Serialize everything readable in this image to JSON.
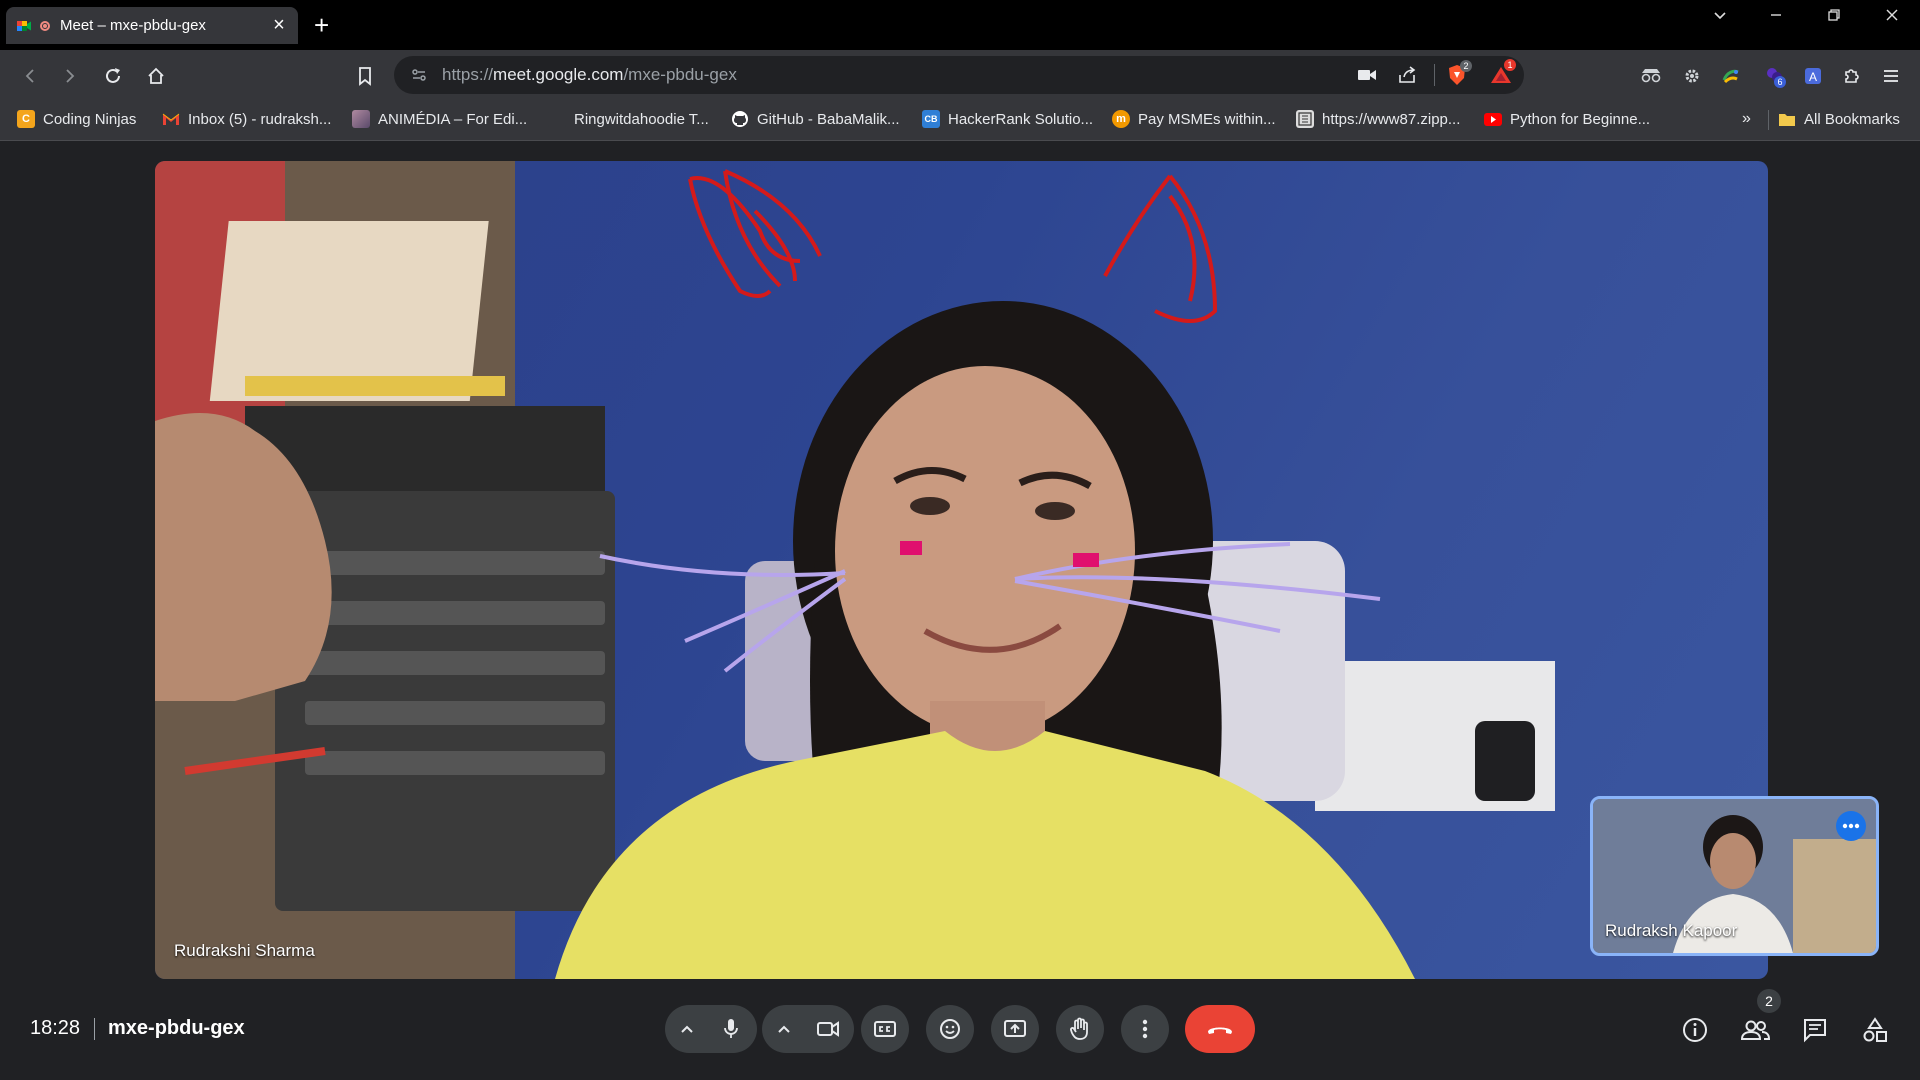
{
  "browser": {
    "tab_title": "Meet – mxe-pbdu-gex",
    "url_prefix": "https://",
    "url_host": "meet.google.com",
    "url_path": "/mxe-pbdu-gex",
    "brave_badge": "2",
    "alert_badge": "1",
    "extension_badge": "6"
  },
  "bookmarks": [
    {
      "label": "Coding Ninjas",
      "icon": "coding-ninjas-icon",
      "color": "#f4a51c"
    },
    {
      "label": "Inbox (5) - rudraksh...",
      "icon": "gmail-icon",
      "color": "#ea4335"
    },
    {
      "label": "ANIMÉDIA – For Edi...",
      "icon": "animedia-icon",
      "color": "#8a6d8f"
    },
    {
      "label": "Ringwitdahoodie T...",
      "icon": "ringwitdahoodie-icon",
      "color": "#444"
    },
    {
      "label": "GitHub - BabaMalik...",
      "icon": "github-icon",
      "color": "#ffffff"
    },
    {
      "label": "HackerRank Solutio...",
      "icon": "hackerrank-icon",
      "color": "#2f7fd6"
    },
    {
      "label": "Pay MSMEs within...",
      "icon": "msme-icon",
      "color": "#f29900"
    },
    {
      "label": "https://www87.zipp...",
      "icon": "zipp-icon",
      "color": "#dddddd"
    },
    {
      "label": "Python for Beginne...",
      "icon": "youtube-icon",
      "color": "#ff0000"
    }
  ],
  "bookmarks_overflow": "»",
  "all_bookmarks": "All Bookmarks",
  "meet": {
    "main_participant": "Rudrakshi Sharma",
    "self_participant": "Rudraksh Kapoor",
    "time": "18:28",
    "meeting_code": "mxe-pbdu-gex",
    "people_count": "2"
  },
  "colors": {
    "accent": "#8ab4f8",
    "leave": "#ea4335",
    "control_bg": "#3c4043",
    "page_bg": "#202124"
  }
}
